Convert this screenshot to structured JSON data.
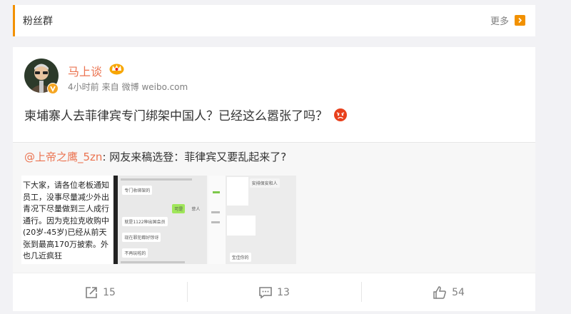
{
  "fans_group": {
    "title": "粉丝群",
    "more_label": "更多",
    "more_icon": "chevron-right-icon",
    "accent_color": "#f29100"
  },
  "post": {
    "username": "马上谈",
    "username_color": "#eb7350",
    "time": "4小时前",
    "from_prefix": "来自",
    "source": "微博 weibo.com",
    "text": "柬埔寨人去菲律宾专门绑架中国人？已经这么嚣张了吗？",
    "repost": {
      "mention": "@上帝之鹰_5zn",
      "text": ": 网友来稿选登：菲律宾又要乱起来了?",
      "image1_lines": [
        "下大家，请各位老板通知",
        "员工，没事尽量减少外出",
        "青况下尽量做到三人成行",
        "通行。因为克拉克收购中",
        "(20岁-45岁)已经从前天",
        "张到最高170万披索。外",
        "也几近疯狂"
      ],
      "image2_bubbles": [
        "专门收绑架的",
        "可是",
        "菲人",
        "就是1122种出国会员",
        "现在罪犯都好惊讶",
        "不再玩啦的"
      ],
      "image3_bubbles": [
        "安排保安和人",
        "宝佳你的"
      ]
    },
    "actions": [
      {
        "icon": "share-icon",
        "count": "15"
      },
      {
        "icon": "comment-icon",
        "count": "13"
      },
      {
        "icon": "like-icon",
        "count": "54"
      }
    ]
  }
}
